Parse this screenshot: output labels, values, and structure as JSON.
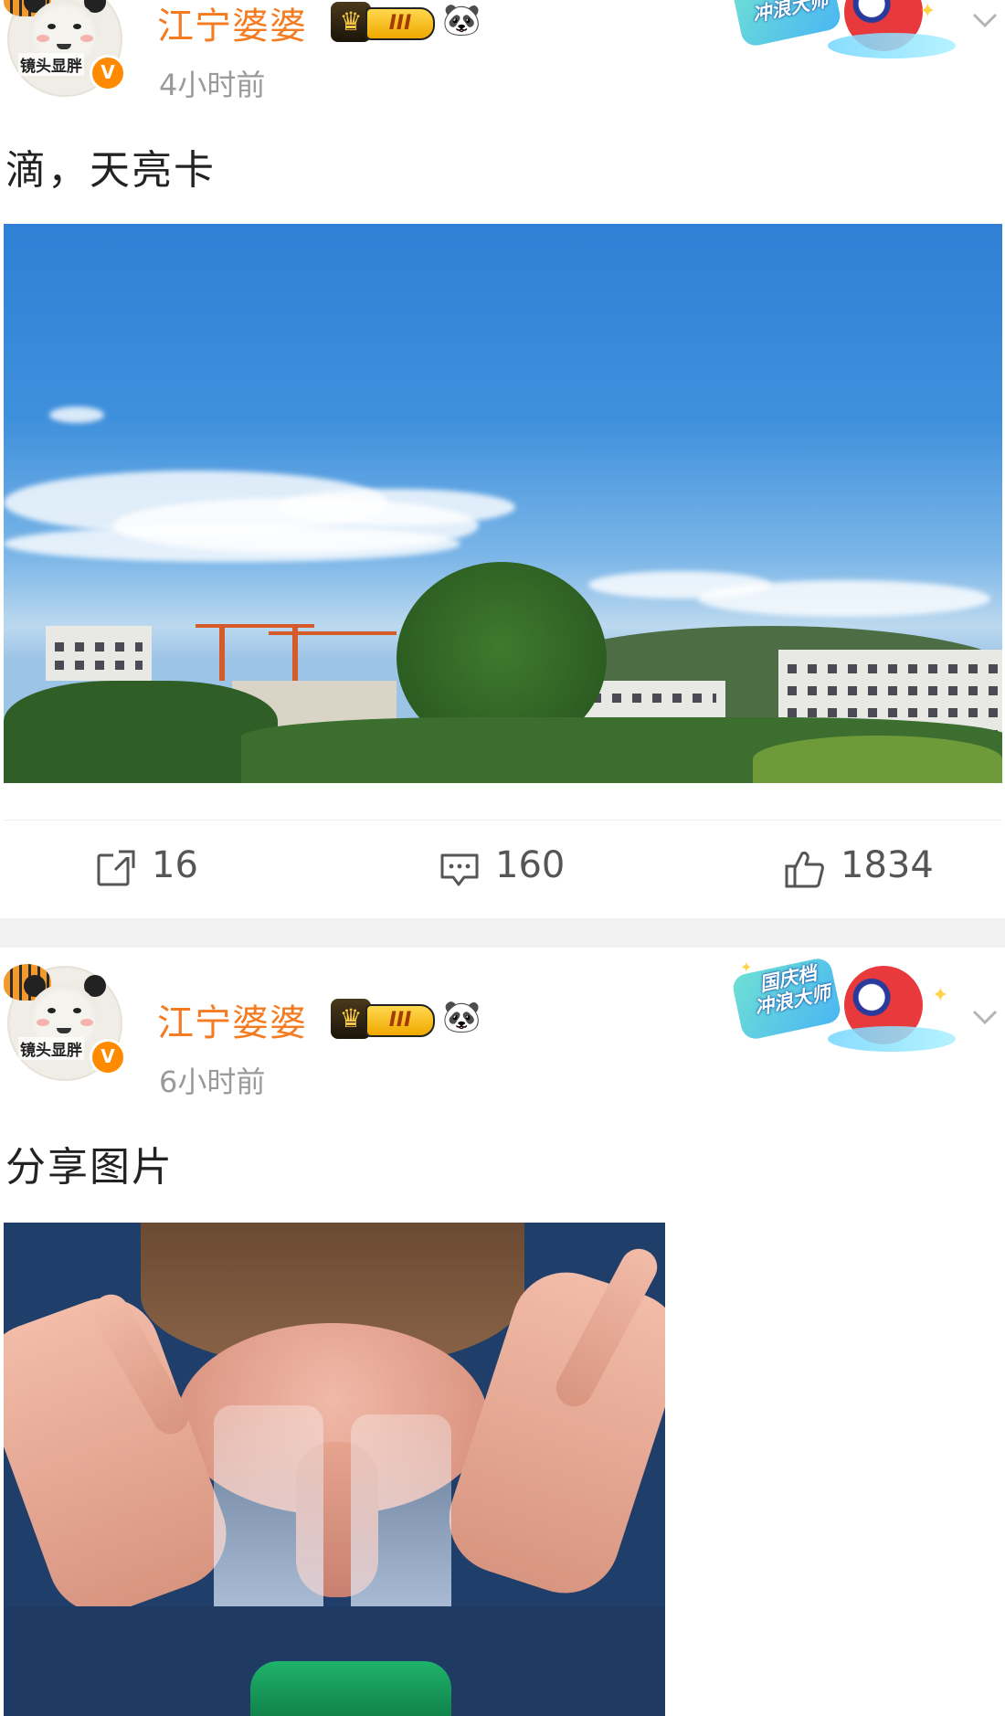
{
  "posts": [
    {
      "author": {
        "name": "江宁婆婆",
        "avatar_caption": "镜头显胖",
        "vip_level": "III",
        "verified_mark": "V"
      },
      "timestamp": "4小时前",
      "promo_badge": "冲浪大师",
      "text": "滴，天亮卡",
      "image": "sky-photo",
      "actions": {
        "repost_count": "16",
        "comment_count": "160",
        "like_count": "1834"
      }
    },
    {
      "author": {
        "name": "江宁婆婆",
        "avatar_caption": "镜头显胖",
        "vip_level": "III",
        "verified_mark": "V"
      },
      "timestamp": "6小时前",
      "promo_badge_line1": "国庆档",
      "promo_badge_line2": "冲浪大师",
      "text": "分享图片",
      "image": "face-wash-photo"
    }
  ],
  "icons": {
    "repost": "repost-icon",
    "comment": "comment-icon",
    "like": "thumbs-up-icon",
    "more": "chevron-down-icon",
    "vip": "crown-icon",
    "badge": "panda-icon"
  },
  "colors": {
    "username": "#f47b20",
    "timestamp": "#9a9a9a",
    "separator": "#f2f2f2",
    "action_text": "#555555"
  }
}
